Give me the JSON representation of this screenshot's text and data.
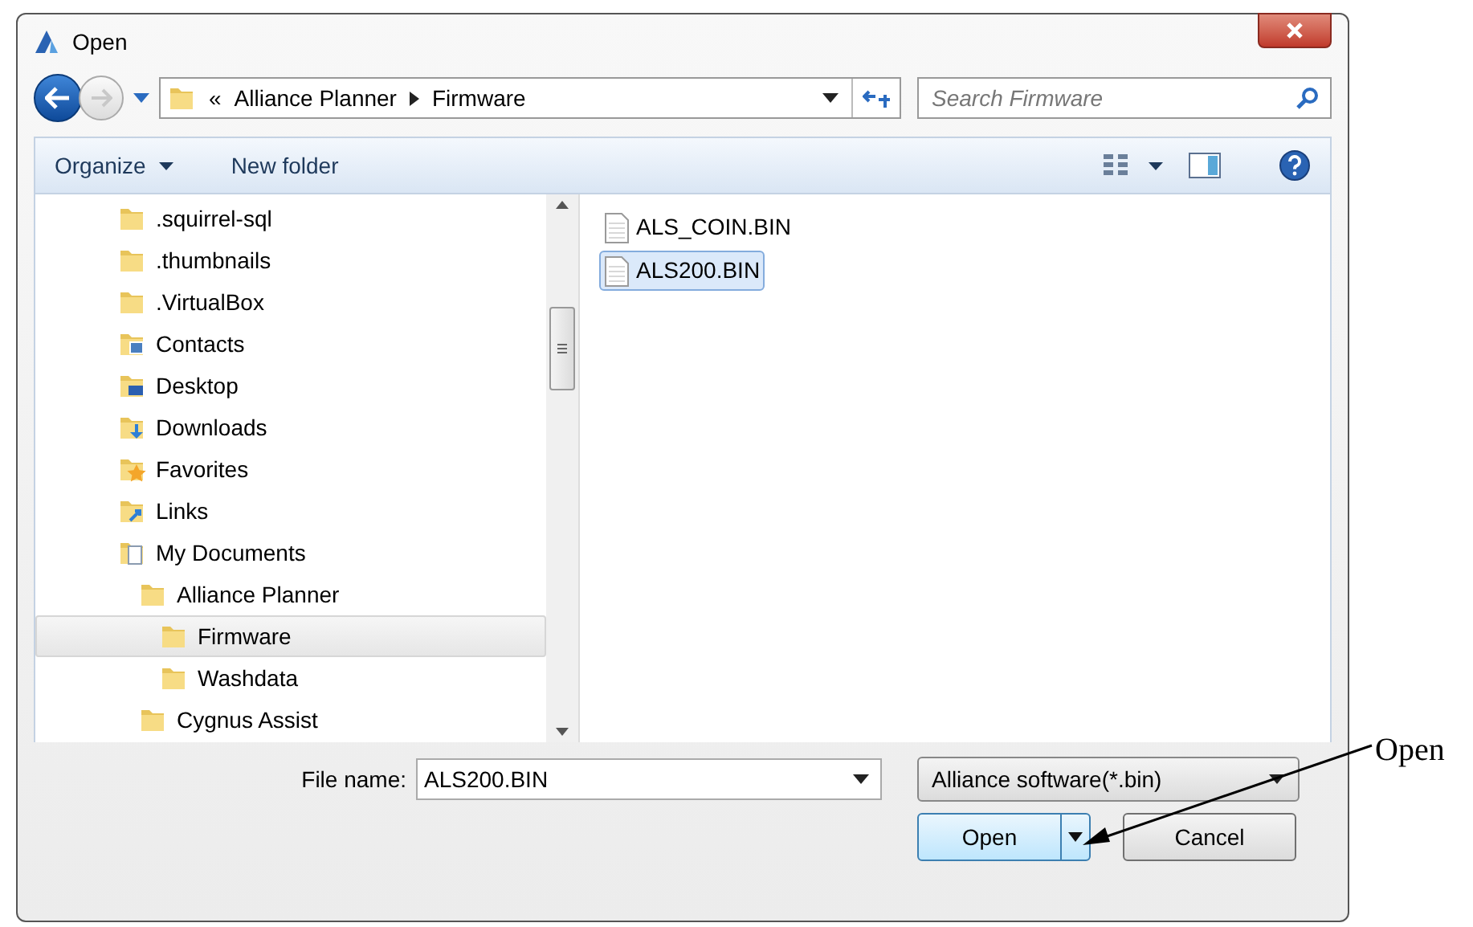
{
  "window": {
    "title": "Open"
  },
  "address": {
    "overflow": "«",
    "path": [
      "Alliance Planner",
      "Firmware"
    ]
  },
  "search": {
    "placeholder": "Search Firmware"
  },
  "toolbar": {
    "buttons": [
      "Organize",
      "New folder"
    ]
  },
  "tree": [
    {
      "label": ".squirrel-sql",
      "kind": "folder",
      "selected": false
    },
    {
      "label": ".thumbnails",
      "kind": "folder",
      "selected": false
    },
    {
      "label": ".VirtualBox",
      "kind": "folder",
      "selected": false
    },
    {
      "label": "Contacts",
      "kind": "contacts",
      "selected": false
    },
    {
      "label": "Desktop",
      "kind": "desktop",
      "selected": false
    },
    {
      "label": "Downloads",
      "kind": "downloads",
      "selected": false
    },
    {
      "label": "Favorites",
      "kind": "favorites",
      "selected": false
    },
    {
      "label": "Links",
      "kind": "links",
      "selected": false
    },
    {
      "label": "My Documents",
      "kind": "documents",
      "selected": false,
      "children": [
        {
          "label": "Alliance Planner",
          "kind": "folder",
          "selected": false,
          "children": [
            {
              "label": "Firmware",
              "kind": "folder",
              "selected": true
            },
            {
              "label": "Washdata",
              "kind": "folder",
              "selected": false
            }
          ]
        },
        {
          "label": "Cygnus Assist",
          "kind": "folder",
          "selected": false
        }
      ]
    }
  ],
  "files": [
    {
      "name": "ALS_COIN.BIN",
      "selected": false
    },
    {
      "name": "ALS200.BIN",
      "selected": true
    }
  ],
  "file_name": {
    "label": "File name:",
    "value": "ALS200.BIN"
  },
  "file_type": {
    "value": "Alliance software(*.bin)"
  },
  "buttons": [
    "Open",
    "Cancel"
  ],
  "callout": {
    "label": "Open"
  }
}
